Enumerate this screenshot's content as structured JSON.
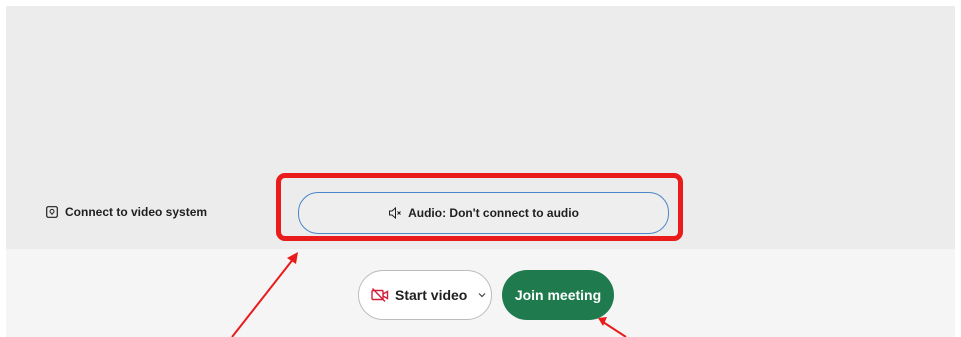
{
  "connect_video": {
    "label": "Connect to video system",
    "icon": "video-system-icon"
  },
  "audio": {
    "label": "Audio: Don't connect to audio",
    "icon": "speaker-muted-icon"
  },
  "start_video": {
    "label": "Start video",
    "icon": "camera-off-icon",
    "chevron_icon": "chevron-down-icon"
  },
  "join": {
    "label": "Join meeting"
  },
  "colors": {
    "join_bg": "#1f7a4d",
    "highlight": "#ea1b1b",
    "audio_border": "#4a86c7",
    "camera_off": "#d11f3a"
  }
}
